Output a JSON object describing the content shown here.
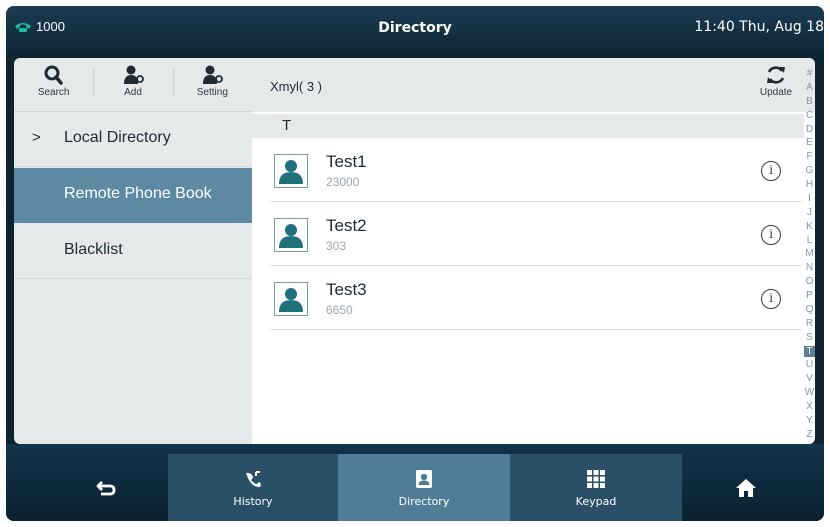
{
  "status_bar": {
    "line": "1000",
    "title": "Directory",
    "datetime": "11:40 Thu, Aug 18"
  },
  "toolbar": {
    "search_label": "Search",
    "add_label": "Add",
    "setting_label": "Setting"
  },
  "menu": {
    "items": [
      {
        "label": "Local Directory",
        "chevron": ">"
      },
      {
        "label": "Remote Phone Book",
        "selected": true
      },
      {
        "label": "Blacklist"
      }
    ]
  },
  "list_header": {
    "group_title": "Xmyl( 3 )",
    "update_label": "Update"
  },
  "section": {
    "letter": "T"
  },
  "contacts": [
    {
      "name": "Test1",
      "number": "23000"
    },
    {
      "name": "Test2",
      "number": "303"
    },
    {
      "name": "Test3",
      "number": "6650"
    }
  ],
  "info_glyph": "i",
  "alphabet": [
    "#",
    "A",
    "B",
    "C",
    "D",
    "E",
    "F",
    "G",
    "H",
    "I",
    "J",
    "K",
    "L",
    "M",
    "N",
    "O",
    "P",
    "Q",
    "R",
    "S",
    "T",
    "U",
    "V",
    "W",
    "X",
    "Y",
    "Z"
  ],
  "alphabet_selected": "T",
  "bottom_bar": {
    "history_label": "History",
    "directory_label": "Directory",
    "keypad_label": "Keypad"
  },
  "colors": {
    "selected_menu": "#5d8aa2",
    "active_softkey": "#4f7c96",
    "softkey": "#2a5068",
    "line_icon": "#1fb89a"
  },
  "icons": [
    "phone-line-icon",
    "search-icon",
    "add-contact-icon",
    "setting-contact-icon",
    "update-icon",
    "contact-avatar-icon",
    "info-icon",
    "back-icon",
    "history-icon",
    "directory-icon",
    "keypad-icon",
    "home-icon"
  ]
}
